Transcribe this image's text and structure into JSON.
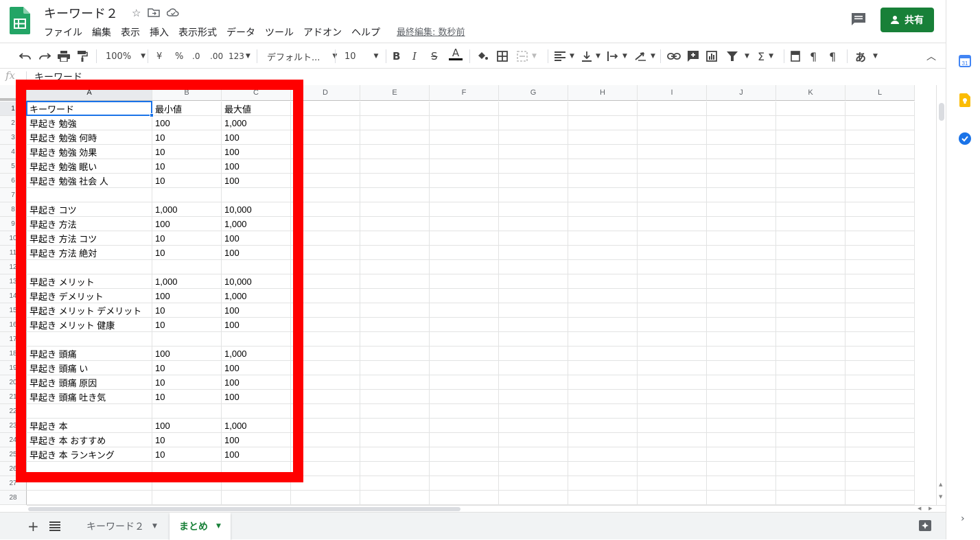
{
  "app": {
    "title": "キーワード２",
    "menu": [
      "ファイル",
      "編集",
      "表示",
      "挿入",
      "表示形式",
      "データ",
      "ツール",
      "アドオン",
      "ヘルプ"
    ],
    "last_edit": "最終編集: 数秒前",
    "share_label": "共有",
    "brand_color": "#188038"
  },
  "toolbar": {
    "zoom": "100%",
    "currency": "¥",
    "percent": "%",
    "decimal_dec": ".0",
    "decimal_inc": ".00",
    "format_123": "123",
    "font": "デフォルト...",
    "font_size": "10",
    "ime": "あ"
  },
  "formula": {
    "fx": "fx",
    "value": "キーワード"
  },
  "grid": {
    "columns": [
      "A",
      "B",
      "C",
      "D",
      "E",
      "F",
      "G",
      "H",
      "I",
      "J",
      "K",
      "L"
    ],
    "rows": [
      [
        "キーワード",
        "最小値",
        "最大値"
      ],
      [
        "早起き 勉強",
        "100",
        "1,000"
      ],
      [
        "早起き 勉強 何時",
        "10",
        "100"
      ],
      [
        "早起き 勉強 効果",
        "10",
        "100"
      ],
      [
        "早起き 勉強 眠い",
        "10",
        "100"
      ],
      [
        "早起き 勉強 社会 人",
        "10",
        "100"
      ],
      [
        "",
        "",
        ""
      ],
      [
        "早起き コツ",
        "1,000",
        "10,000"
      ],
      [
        "早起き 方法",
        "100",
        "1,000"
      ],
      [
        "早起き 方法 コツ",
        "10",
        "100"
      ],
      [
        "早起き 方法 絶対",
        "10",
        "100"
      ],
      [
        "",
        "",
        ""
      ],
      [
        "早起き メリット",
        "1,000",
        "10,000"
      ],
      [
        "早起き デメリット",
        "100",
        "1,000"
      ],
      [
        "早起き メリット デメリット",
        "10",
        "100"
      ],
      [
        "早起き メリット 健康",
        "10",
        "100"
      ],
      [
        "",
        "",
        ""
      ],
      [
        "早起き 頭痛",
        "100",
        "1,000"
      ],
      [
        "早起き 頭痛 い",
        "10",
        "100"
      ],
      [
        "早起き 頭痛 原因",
        "10",
        "100"
      ],
      [
        "早起き 頭痛 吐き気",
        "10",
        "100"
      ],
      [
        "",
        "",
        ""
      ],
      [
        "早起き 本",
        "100",
        "1,000"
      ],
      [
        "早起き 本 おすすめ",
        "10",
        "100"
      ],
      [
        "早起き 本 ランキング",
        "10",
        "100"
      ],
      [
        "",
        "",
        ""
      ],
      [
        "",
        "",
        ""
      ],
      [
        "",
        "",
        ""
      ]
    ],
    "highlight_color": "#ff0000",
    "selection_color": "#1a73e8"
  },
  "sheets": {
    "tabs": [
      "キーワード２",
      "まとめ"
    ],
    "active": "まとめ"
  }
}
